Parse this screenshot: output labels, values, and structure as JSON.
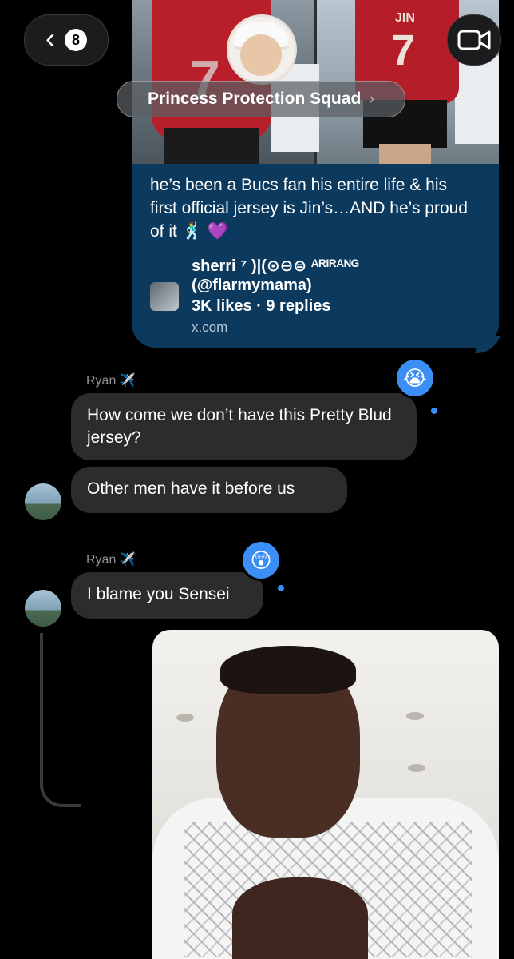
{
  "header": {
    "back_count": "8",
    "group_name": "Princess Protection Squad"
  },
  "shared_post": {
    "image_jersey_name": "JIN",
    "image_jersey_number": "7",
    "image_jersey_number_left": "7",
    "text": "he’s been a Bucs fan his entire life & his first official jersey is Jin’s…AND he’s proud of it 🕺 💜",
    "author": "sherri ⁷ )|(⊙⊖⊜ ᴬᴿᴵᴿᴬᴺᴳ",
    "handle": "(@flarmymama)",
    "stats": "3K likes · 9 replies",
    "domain": "x.com"
  },
  "messages": [
    {
      "sender": "Ryan ✈️",
      "text": "How come we don’t have this Pretty Blud jersey?",
      "reaction": "😭"
    },
    {
      "sender": "",
      "text": "Other men have it before us",
      "reaction": ""
    },
    {
      "sender": "Ryan ✈️",
      "text": "I blame you Sensei",
      "reaction": "😲"
    }
  ]
}
